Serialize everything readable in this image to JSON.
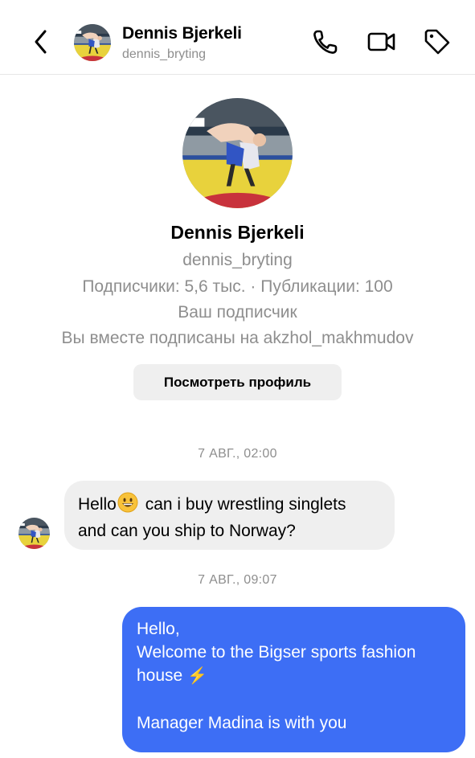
{
  "header": {
    "name": "Dennis Bjerkeli",
    "username": "dennis_bryting",
    "icons": [
      "back-chevron-icon",
      "phone-icon",
      "video-camera-icon",
      "tag-icon"
    ]
  },
  "profile": {
    "name": "Dennis Bjerkeli",
    "username": "dennis_bryting",
    "stats": "Подписчики: 5,6 тыс. · Публикации: 100",
    "follow_status": "Ваш подписчик",
    "mutual": "Вы вместе подписаны на akzhol_makhmudov",
    "view_profile_label": "Посмотреть профиль"
  },
  "messages": [
    {
      "timestamp": "7 АВГ., 02:00",
      "direction": "incoming",
      "text_before_emoji": "Hello",
      "emoji": "grinning-face",
      "text_after_emoji": " can i buy wrestling singlets",
      "text_line2": "and can you ship to Norway?"
    },
    {
      "timestamp": "7 АВГ., 09:07",
      "direction": "outgoing",
      "lines": [
        "Hello,",
        "Welcome to the Bigser sports fashion",
        "house",
        "",
        "Manager Madina is with you"
      ],
      "emoji": "⚡"
    }
  ],
  "colors": {
    "outgoing_bubble": "#3d6ef5",
    "incoming_bubble": "#efefef",
    "secondary_text": "#8e8e8e",
    "wrestling_mat_yellow": "#e8d23c",
    "wrestling_mat_red": "#c8323c"
  }
}
